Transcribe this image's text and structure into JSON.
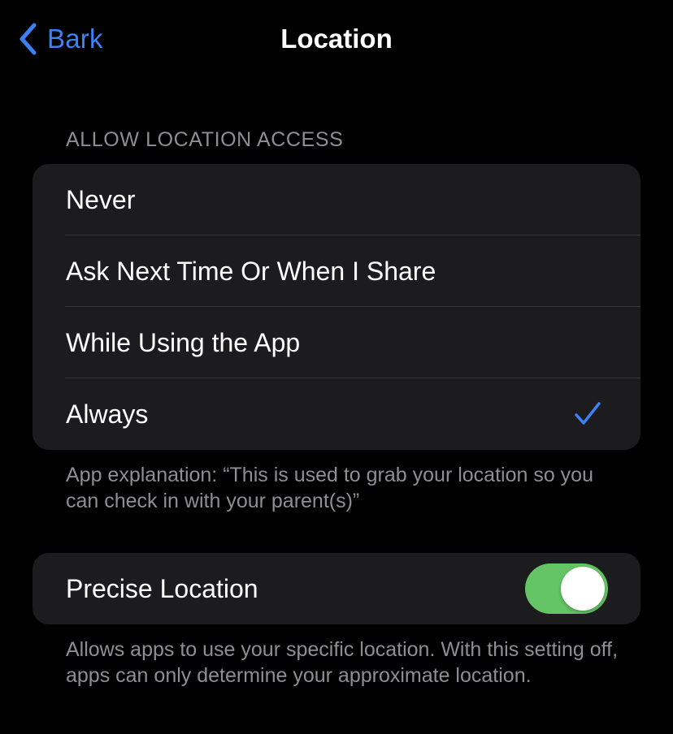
{
  "nav": {
    "back_label": "Bark",
    "title": "Location",
    "accent_color": "#3b82f6"
  },
  "access": {
    "section_header": "ALLOW LOCATION ACCESS",
    "options": [
      {
        "label": "Never",
        "selected": false
      },
      {
        "label": "Ask Next Time Or When I Share",
        "selected": false
      },
      {
        "label": "While Using the App",
        "selected": false
      },
      {
        "label": "Always",
        "selected": true
      }
    ],
    "footnote": "App explanation: “This is used to grab your location so you can check in with your parent(s)”"
  },
  "precise": {
    "label": "Precise Location",
    "enabled": true,
    "toggle_color": "#65c466",
    "footnote": "Allows apps to use your specific location. With this setting off, apps can only determine your approximate location."
  },
  "icons": {
    "back": "chevron-left-icon",
    "selected": "checkmark-icon"
  }
}
